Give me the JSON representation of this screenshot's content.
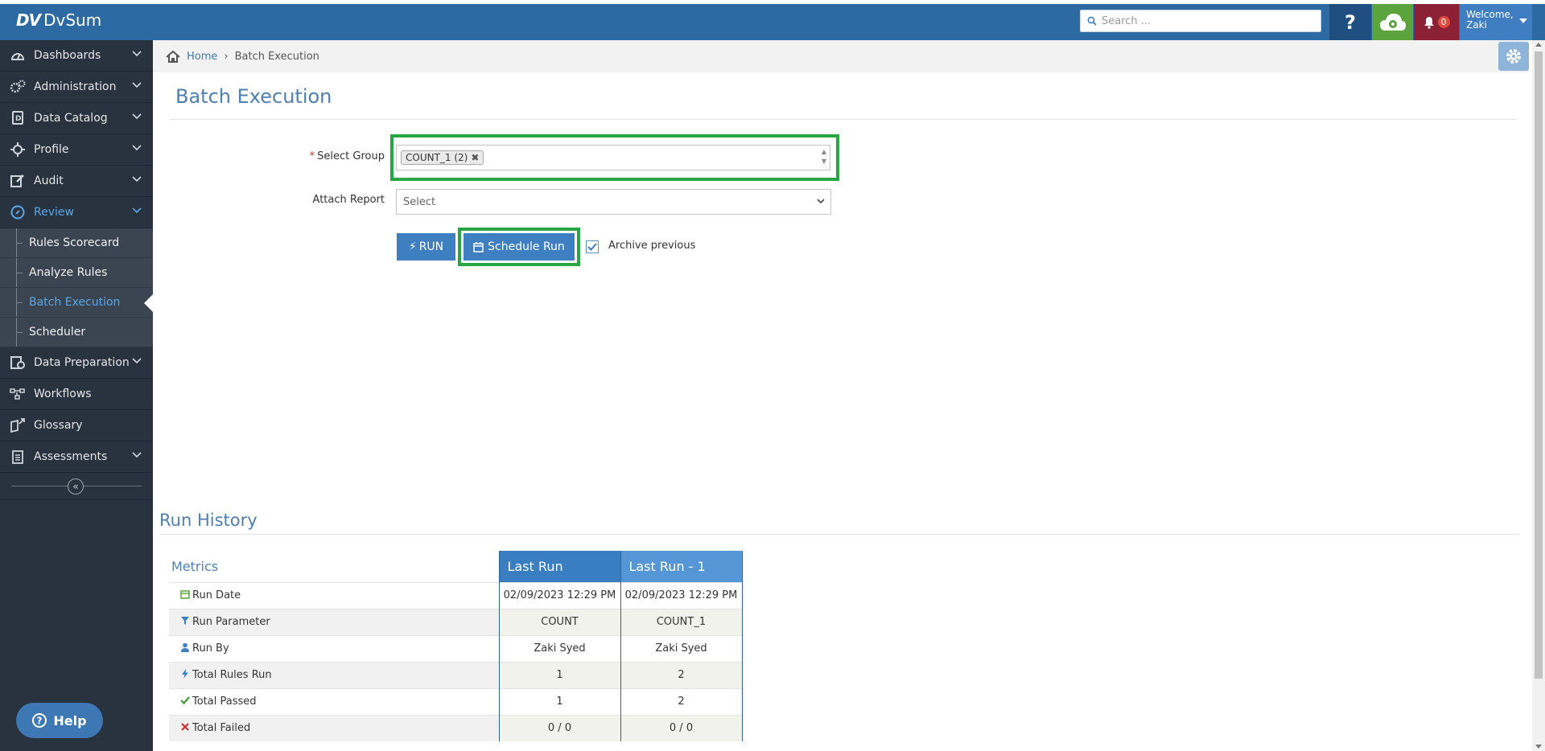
{
  "app": {
    "name": "DvSum",
    "logo_mark": "DV"
  },
  "header": {
    "search_placeholder": "Search ...",
    "help_label": "?",
    "notifications_count": "0",
    "welcome_label": "Welcome,",
    "user_name": "Zaki"
  },
  "sidebar": {
    "items": [
      {
        "label": "Dashboards",
        "icon": "dashboard-icon"
      },
      {
        "label": "Administration",
        "icon": "cogs-icon"
      },
      {
        "label": "Data Catalog",
        "icon": "catalog-icon"
      },
      {
        "label": "Profile",
        "icon": "crosshair-icon"
      },
      {
        "label": "Audit",
        "icon": "edit-icon"
      },
      {
        "label": "Review",
        "icon": "compass-icon"
      }
    ],
    "review_sub": [
      "Rules Scorecard",
      "Analyze Rules",
      "Batch Execution",
      "Scheduler"
    ],
    "items_after": [
      {
        "label": "Data Preparation",
        "icon": "data-prep-icon"
      },
      {
        "label": "Workflows",
        "icon": "workflow-icon"
      },
      {
        "label": "Glossary",
        "icon": "glossary-icon"
      },
      {
        "label": "Assessments",
        "icon": "clipboard-icon"
      }
    ],
    "help_label": "Help"
  },
  "breadcrumb": {
    "home": "Home",
    "current": "Batch Execution"
  },
  "page": {
    "title": "Batch Execution"
  },
  "form": {
    "select_group_label": "Select Group",
    "required_mark": "*",
    "selected_tag": "COUNT_1 (2)",
    "attach_report_label": "Attach Report",
    "attach_report_placeholder": "Select",
    "run_label": "RUN",
    "schedule_label": "Schedule Run",
    "archive_label": "Archive previous",
    "archive_checked": true
  },
  "run_history": {
    "title": "Run History",
    "metrics_header": "Metrics",
    "columns": [
      "Last Run",
      "Last Run - 1"
    ],
    "rows": [
      {
        "metric": "Run Date",
        "icon": "calendar-icon",
        "values": [
          "02/09/2023 12:29 PM",
          "02/09/2023 12:29 PM"
        ]
      },
      {
        "metric": "Run Parameter",
        "icon": "filter-icon",
        "values": [
          "COUNT",
          "COUNT_1"
        ]
      },
      {
        "metric": "Run By",
        "icon": "user-icon",
        "values": [
          "Zaki Syed",
          "Zaki Syed"
        ]
      },
      {
        "metric": "Total Rules Run",
        "icon": "bolt-icon",
        "values": [
          "1",
          "2"
        ]
      },
      {
        "metric": "Total Passed",
        "icon": "check-icon",
        "values": [
          "1",
          "2"
        ]
      },
      {
        "metric": "Total Failed",
        "icon": "x-icon",
        "values": [
          "0 / 0",
          "0 / 0"
        ]
      }
    ]
  },
  "colors": {
    "header_bg": "#2d69a3",
    "sidebar_bg": "#28333f",
    "accent": "#3d7fc1",
    "highlight": "#27a744"
  }
}
